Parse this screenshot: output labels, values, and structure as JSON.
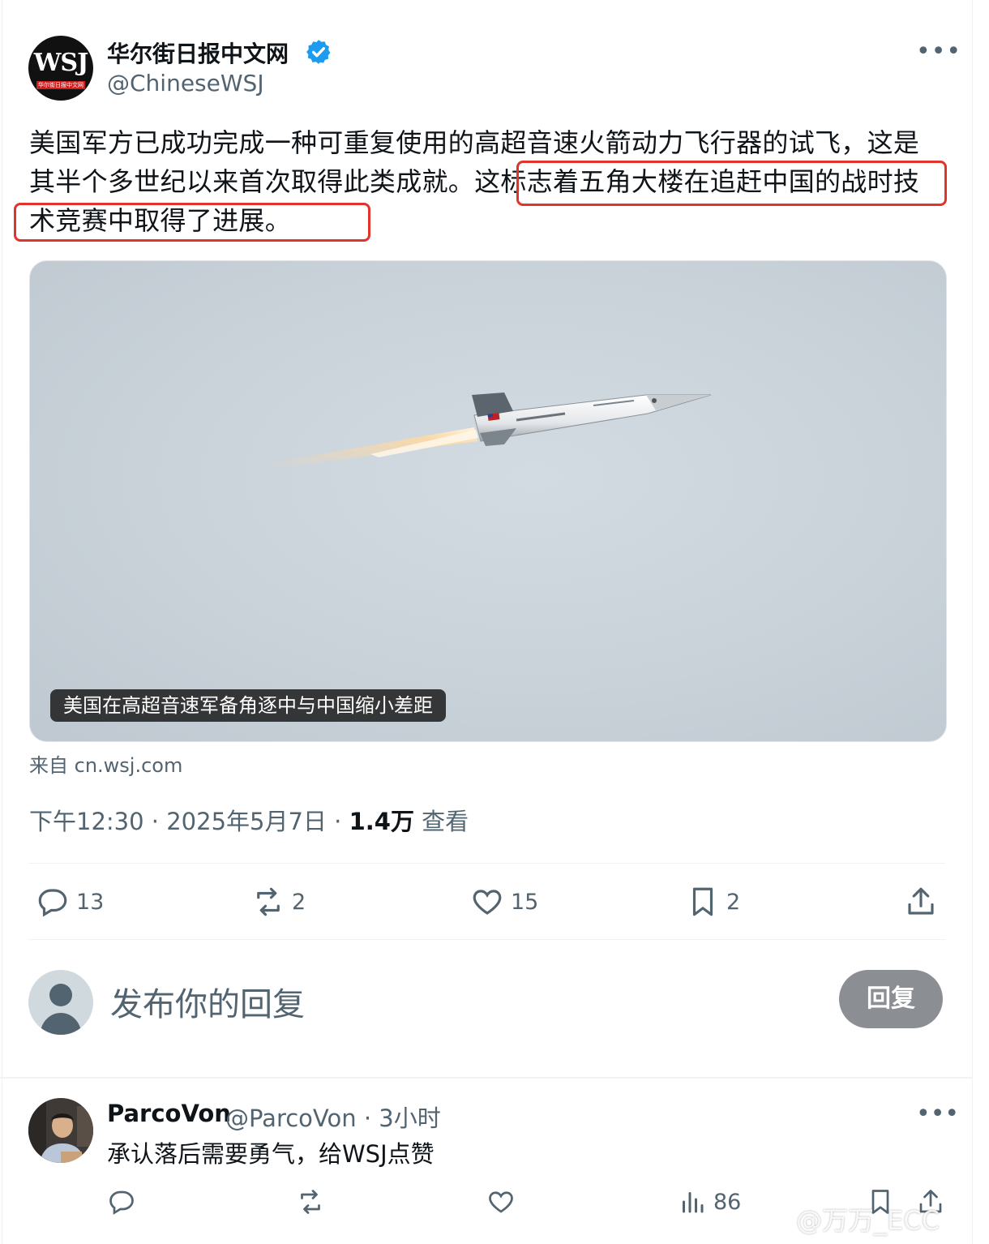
{
  "author": {
    "display_name": "华尔街日报中文网",
    "handle": "@ChineseWSJ",
    "avatar_text": "WSJ",
    "avatar_band_text": "华尔街日报中文网"
  },
  "tweet": {
    "text_part1": "美国军方已成功完成一种可重复使用的高超音速火箭动力飞行器的试飞，这是其半个多世纪以来首次取得此类成就。",
    "text_part2": "这标志着五角大楼在追赶中国的战时技术竞赛中取得了进展。",
    "media_caption": "美国在高超音速军备角逐中与中国缩小差距",
    "source": "来自 cn.wsj.com",
    "time": "下午12:30 · 2025年5月7日 · ",
    "views": "1.4万",
    "views_label": " 查看"
  },
  "actions": {
    "replies": "13",
    "retweets": "2",
    "likes": "15",
    "bookmarks": "2"
  },
  "composer": {
    "placeholder": "发布你的回复",
    "button": "回复"
  },
  "comment": {
    "name": "ParcoVon",
    "meta": "@ParcoVon · 3小时",
    "text": "承认落后需要勇气，给WSJ点赞",
    "views": "86"
  },
  "watermark": "@万万_ECC",
  "colors": {
    "highlight": "#e0352b",
    "verified": "#1d9bf0",
    "secondary_text": "#536471"
  }
}
